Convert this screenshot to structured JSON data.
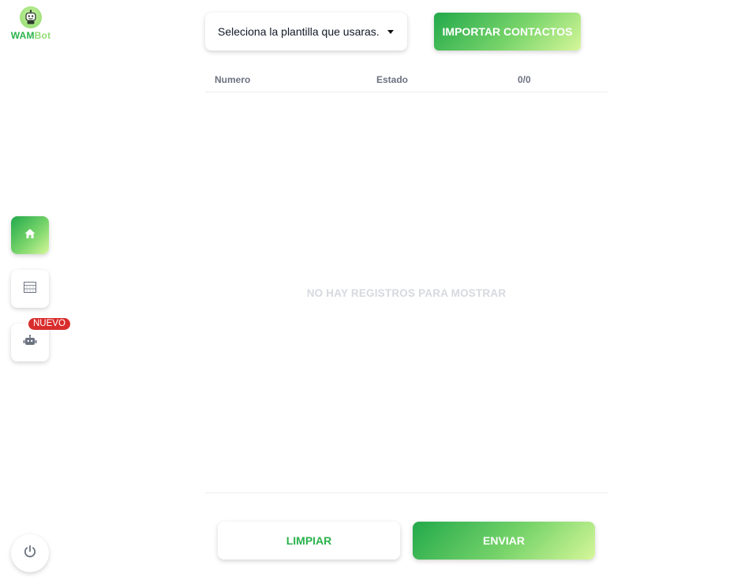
{
  "app": {
    "logo_main": "WAM",
    "logo_accent": "Bot"
  },
  "sidebar": {
    "items": [
      {
        "name": "home",
        "icon": "home-icon",
        "active": true
      },
      {
        "name": "templates",
        "icon": "grid-icon",
        "active": false
      },
      {
        "name": "bot",
        "icon": "robot-icon",
        "active": false,
        "badge": "NUEVO"
      }
    ],
    "power_icon": "power-icon"
  },
  "toolbar": {
    "template_select_value": "Seleciona la plantilla que usaras.",
    "import_label": "IMPORTAR CONTACTOS"
  },
  "table": {
    "columns": [
      "Numero",
      "Estado",
      "0/0"
    ],
    "empty_message": "NO HAY REGISTROS PARA MOSTRAR"
  },
  "actions": {
    "clear_label": "LIMPIAR",
    "send_label": "ENVIAR"
  },
  "colors": {
    "accent_green": "#2bb24c",
    "gradient_start": "#22a94b",
    "gradient_end": "#d6f79a",
    "badge_red": "#d92d2d"
  }
}
